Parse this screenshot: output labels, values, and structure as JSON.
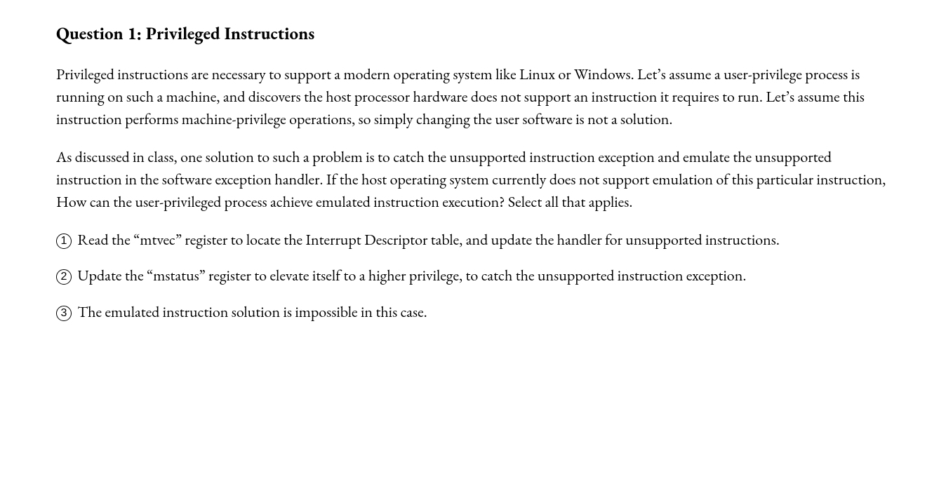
{
  "heading": "Question 1: Privileged Instructions",
  "paragraphs": [
    "Privileged instructions are necessary to support a modern operating system like Linux or Windows. Let’s assume a user-privilege process is running on such a machine, and discovers the host processor hardware does not support an instruction it requires to run. Let’s assume this instruction performs machine-privilege operations, so simply changing the user software is not a solution.",
    "As discussed in class, one solution to such a problem is to catch the unsupported instruction exception and emulate the unsupported instruction in the software exception handler. If the host operating system currently does not support emulation of this particular instruction, How can the user-privileged process achieve emulated instruction execution? Select all that applies."
  ],
  "options": [
    {
      "num": "1",
      "text": " Read the “mtvec” register to locate the Interrupt Descriptor table, and update the handler for unsupported instructions."
    },
    {
      "num": "2",
      "text": " Update the “mstatus” register to elevate itself to a higher privilege, to catch the unsupported instruction exception."
    },
    {
      "num": "3",
      "text": " The emulated instruction solution is impossible in this case."
    }
  ]
}
